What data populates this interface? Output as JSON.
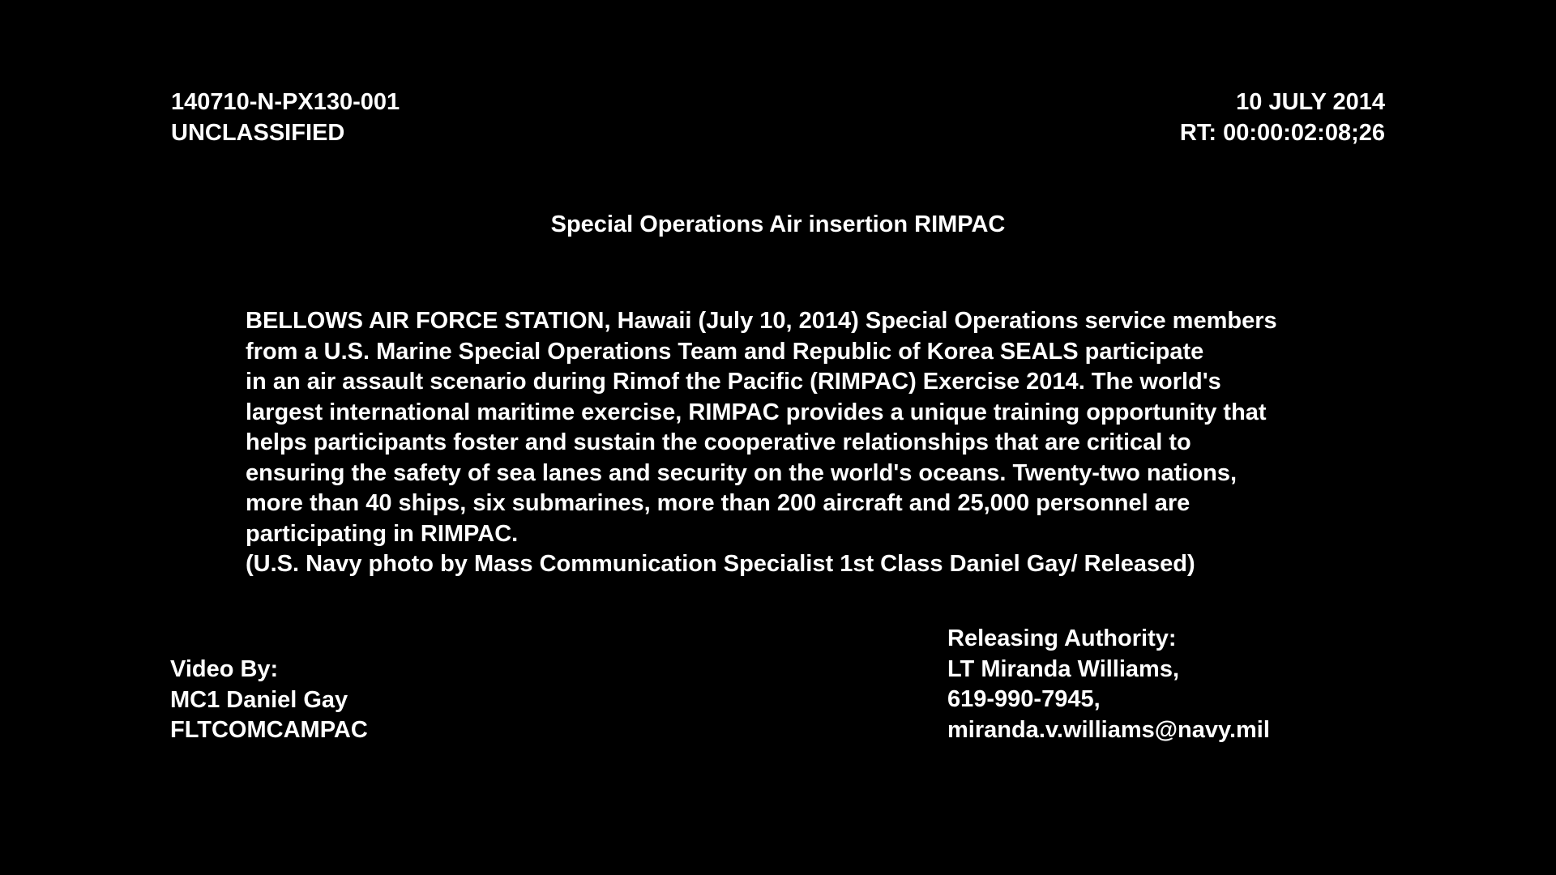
{
  "header": {
    "left": {
      "id_code": "140710-N-PX130-001",
      "classification": "UNCLASSIFIED"
    },
    "right": {
      "date": "10 JULY 2014",
      "runtime": "RT: 00:00:02:08;26"
    }
  },
  "title": "Special Operations Air insertion RIMPAC",
  "description": {
    "lines": [
      "BELLOWS AIR FORCE STATION, Hawaii (July 10, 2014) Special Operations service members",
      "from a U.S. Marine Special Operations Team and Republic of Korea SEALS participate",
      "in an air assault scenario during Rimof the Pacific (RIMPAC) Exercise 2014. The world's",
      "largest international maritime exercise, RIMPAC provides a unique training opportunity that",
      "helps participants foster and sustain the cooperative relationships that are critical to",
      "ensuring the safety of sea lanes and security on the world's oceans. Twenty-two nations,",
      "more than 40 ships, six submarines, more than 200 aircraft and 25,000 personnel are",
      "participating in RIMPAC.",
      "(U.S. Navy photo by Mass Communication Specialist 1st Class Daniel Gay/ Released)"
    ]
  },
  "credits": {
    "video_by": {
      "label": "Video By:",
      "name": "MC1 Daniel Gay",
      "unit": "FLTCOMCAMPAC"
    },
    "releasing_authority": {
      "label": "Releasing Authority:",
      "name": "LT Miranda Williams,",
      "phone": "619-990-7945,",
      "email": "miranda.v.williams@navy.mil"
    }
  },
  "colors": {
    "background": "#000000",
    "text": "#ffffff"
  }
}
